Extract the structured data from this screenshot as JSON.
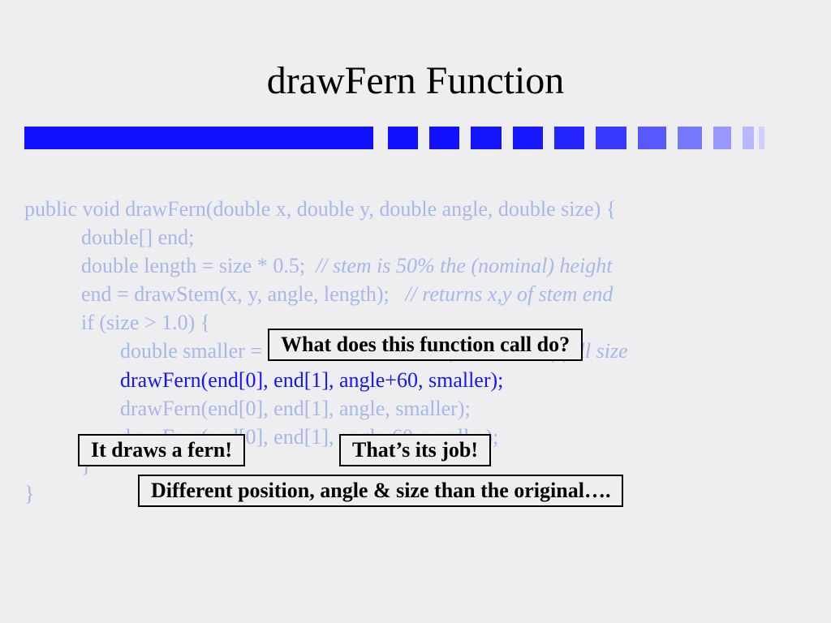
{
  "title": "drawFern Function",
  "code": {
    "l1": "public void drawFern(double x, double y, double angle, double size) {",
    "l2": "double[] end;",
    "l3a": "double length = size * 0.5;  ",
    "l3b": "// stem is 50% the (nominal) height",
    "l4a": "end = drawStem(x, y, angle, length);   ",
    "l4b": "// returns x,y of stem end",
    "l5": "if (size > 1.0) {",
    "l6a": "double smaller = size * 0.4;  ",
    "l6b": "// smaller ferns 40% of full size",
    "l7": "drawFern(end[0], end[1], angle+60, smaller);",
    "l8": "drawFern(end[0], end[1], angle, smaller);",
    "l9": "drawFern(end[0], end[1], angle-60, smaller);",
    "l10": "}",
    "l11": "}"
  },
  "callouts": {
    "c1": "What does this function call do?",
    "c2": "It draws a fern!",
    "c3": "That’s its job!",
    "c4": "Different position, angle & size than the original…."
  },
  "divider_colors": [
    "#1010ff",
    "#1010ff",
    "#1414ff",
    "#1818ff",
    "#2424ff",
    "#3838ff",
    "#5858ff",
    "#7878ff",
    "#9898ff",
    "#b8b8ff",
    "#d0d0ff"
  ],
  "divider_widths": [
    40,
    40,
    40,
    40,
    40,
    40,
    38,
    32,
    24,
    14,
    8
  ]
}
